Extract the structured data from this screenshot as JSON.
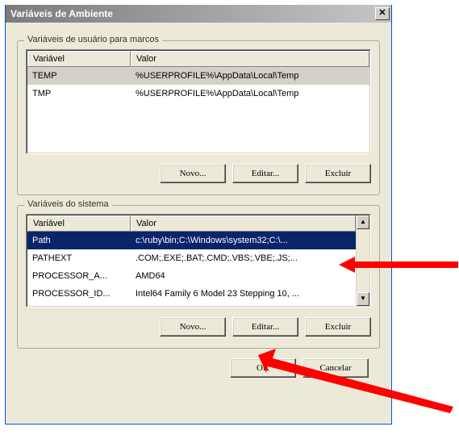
{
  "window": {
    "title": "Variáveis de Ambiente"
  },
  "user_group": {
    "legend": "Variáveis de usuário para marcos",
    "col_var": "Variável",
    "col_val": "Valor",
    "rows": [
      {
        "var": "TEMP",
        "val": "%USERPROFILE%\\AppData\\Local\\Temp"
      },
      {
        "var": "TMP",
        "val": "%USERPROFILE%\\AppData\\Local\\Temp"
      }
    ],
    "btn_new": "Novo...",
    "btn_edit": "Editar...",
    "btn_del": "Excluir"
  },
  "system_group": {
    "legend": "Variáveis do sistema",
    "col_var": "Variável",
    "col_val": "Valor",
    "rows": [
      {
        "var": "Path",
        "val": "c:\\ruby\\bin;C:\\Windows\\system32;C:\\..."
      },
      {
        "var": "PATHEXT",
        "val": ".COM;.EXE;.BAT;.CMD;.VBS;.VBE;.JS;..."
      },
      {
        "var": "PROCESSOR_A...",
        "val": "AMD64"
      },
      {
        "var": "PROCESSOR_ID...",
        "val": "Intel64 Family 6 Model 23 Stepping 10, ..."
      }
    ],
    "btn_new": "Novo...",
    "btn_edit": "Editar...",
    "btn_del": "Excluir"
  },
  "dialog_buttons": {
    "ok": "OK",
    "cancel": "Cancelar"
  },
  "close_glyph": "✕"
}
